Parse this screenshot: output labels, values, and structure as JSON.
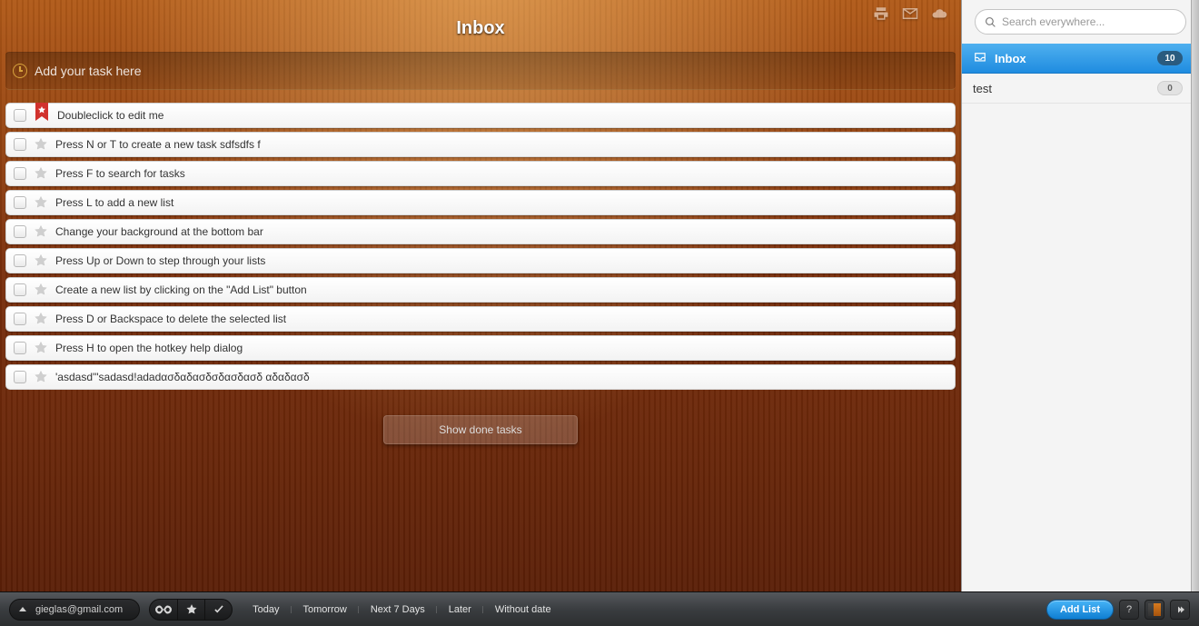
{
  "header": {
    "title": "Inbox"
  },
  "addTask": {
    "placeholder": "Add your task here"
  },
  "tasks": [
    {
      "label": "Doubleclick to edit me",
      "flag": true
    },
    {
      "label": "Press N or T to create a new task sdfsdfs f",
      "flag": false
    },
    {
      "label": "Press F to search for tasks",
      "flag": false
    },
    {
      "label": "Press L to add a new list",
      "flag": false
    },
    {
      "label": "Change your background at the bottom bar",
      "flag": false
    },
    {
      "label": "Press Up or Down to step through your lists",
      "flag": false
    },
    {
      "label": "Create a new list by clicking on the \"Add List\" button",
      "flag": false
    },
    {
      "label": "Press D or Backspace to delete the selected list",
      "flag": false
    },
    {
      "label": "Press H to open the hotkey help dialog",
      "flag": false
    },
    {
      "label": "'asdasd'\"sadasd!adadασδαδασδσδασδασδ αδαδασδ",
      "flag": false
    }
  ],
  "showDone": "Show done tasks",
  "search": {
    "placeholder": "Search everywhere..."
  },
  "lists": [
    {
      "name": "Inbox",
      "count": "10",
      "active": true,
      "icon": true
    },
    {
      "name": "test",
      "count": "0",
      "active": false,
      "icon": false
    }
  ],
  "bottom": {
    "account": "gieglas@gmail.com",
    "filters": [
      "Today",
      "Tomorrow",
      "Next 7 Days",
      "Later",
      "Without date"
    ],
    "addList": "Add List",
    "help": "?"
  }
}
